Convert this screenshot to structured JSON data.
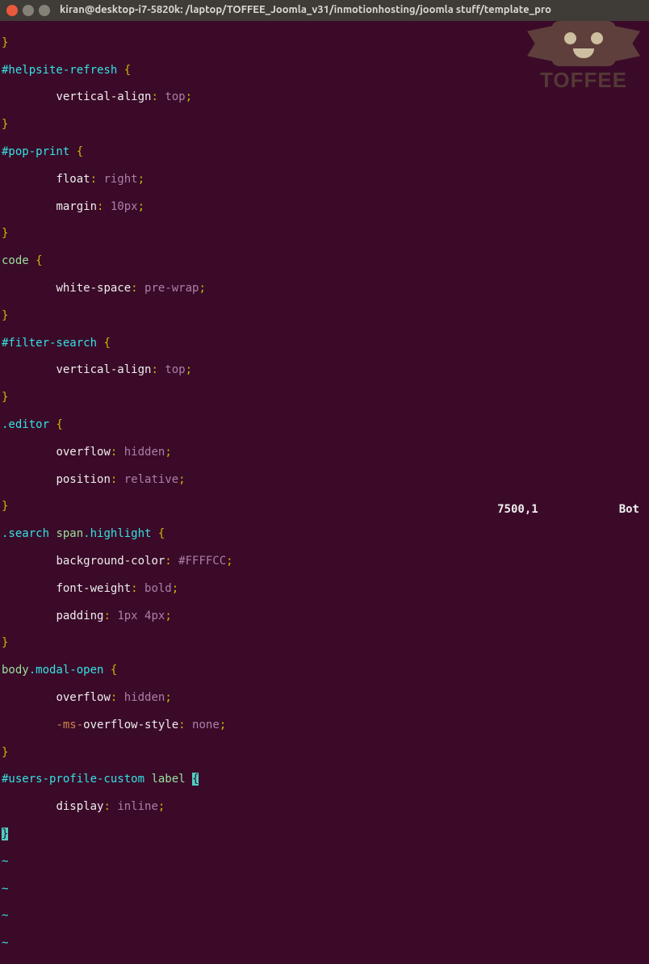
{
  "titlebar": {
    "title": "kiran@desktop-i7-5820k: /laptop/TOFFEE_Joomla_v31/inmotionhosting/joomla stuff/template_pro"
  },
  "logo": {
    "text": "TOFFEE"
  },
  "code": {
    "l0": "}",
    "r1_sel": "#helpsite-refresh",
    "r1_brace": " {",
    "r1_prop": "vertical-align",
    "r1_val": "top",
    "r2": "}",
    "r3_sel": "#pop-print",
    "r3_brace": " {",
    "r3_p1": "float",
    "r3_v1": "right",
    "r3_p2": "margin",
    "r3_v2": "10px",
    "r4": "}",
    "r5_sel": "code",
    "r5_brace": " {",
    "r5_p1": "white-space",
    "r5_v1": "pre-wrap",
    "r6": "}",
    "r7_sel": "#filter-search",
    "r7_brace": " {",
    "r7_p1": "vertical-align",
    "r7_v1": "top",
    "r8": "}",
    "r9_sel": ".editor",
    "r9_brace": " {",
    "r9_p1": "overflow",
    "r9_v1": "hidden",
    "r9_p2": "position",
    "r9_v2": "relative",
    "r10": "}",
    "r11_a": ".search",
    "r11_b": " span",
    "r11_c": ".highlight",
    "r11_brace": " {",
    "r11_p1": "background-color",
    "r11_v1": "#FFFFCC",
    "r11_p2": "font-weight",
    "r11_v2": "bold",
    "r11_p3": "padding",
    "r11_v3": "1px 4px",
    "r12": "}",
    "r13_a": "body",
    "r13_b": ".modal-open",
    "r13_brace": " {",
    "r13_p1": "overflow",
    "r13_v1": "hidden",
    "r13_p2a": "-ms-",
    "r13_p2b": "overflow-style",
    "r13_v2": "none",
    "r14": "}",
    "r15_a": "#users-profile-custom",
    "r15_b": " label",
    "r15_cursor": "{",
    "r15_p1": "display",
    "r15_v1": "inline",
    "r16_cursor": "}",
    "indent": "        ",
    "colon": ": ",
    "semi": ";",
    "tilde": "~"
  },
  "status": {
    "pos": "7500,1",
    "loc": "Bot"
  }
}
